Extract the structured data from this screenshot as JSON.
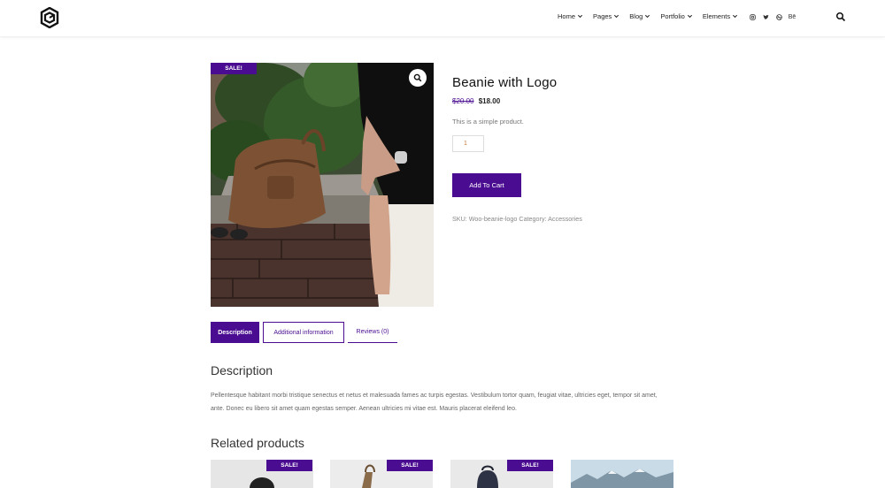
{
  "nav": {
    "items": [
      {
        "label": "Home"
      },
      {
        "label": "Pages"
      },
      {
        "label": "Blog"
      },
      {
        "label": "Portfolio"
      },
      {
        "label": "Elements"
      }
    ],
    "social": [
      "instagram-icon",
      "twitter-icon",
      "dribbble-icon",
      "behance-icon"
    ],
    "behance_label": "Bē"
  },
  "product": {
    "sale_badge": "SALE!",
    "title": "Beanie with Logo",
    "price_old": "$20.00",
    "price_new": "$18.00",
    "short_description": "This is a simple product.",
    "quantity": "1",
    "add_to_cart": "Add To Cart",
    "meta": "SKU: Woo-beanie-logo Category: Accessories"
  },
  "tabs": {
    "description": "Description",
    "additional": "Additional information",
    "reviews": "Reviews (0)"
  },
  "description": {
    "heading": "Description",
    "text": "Pellentesque habitant morbi tristique senectus et netus et malesuada fames ac turpis egestas. Vestibulum tortor quam, feugiat vitae, ultricies eget, tempor sit amet, ante. Donec eu libero sit amet quam egestas semper. Aenean ultricies mi vitae est. Mauris placerat eleifend leo."
  },
  "related": {
    "heading": "Related products",
    "badges": [
      "SALE!",
      "SALE!",
      "SALE!"
    ]
  },
  "colors": {
    "accent": "#4a0c90"
  }
}
